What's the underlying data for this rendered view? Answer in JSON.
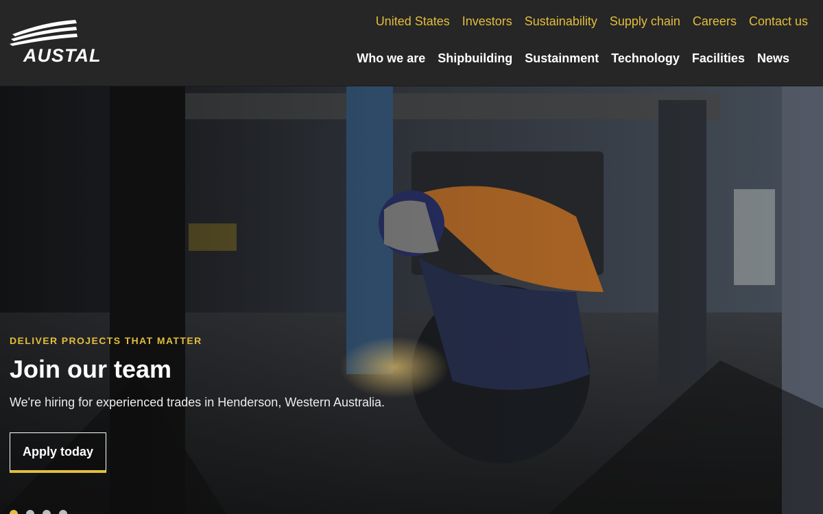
{
  "brand": {
    "name": "AUSTAL"
  },
  "utility_nav": [
    "United States",
    "Investors",
    "Sustainability",
    "Supply chain",
    "Careers",
    "Contact us"
  ],
  "main_nav": [
    "Who we are",
    "Shipbuilding",
    "Sustainment",
    "Technology",
    "Facilities",
    "News"
  ],
  "hero": {
    "eyebrow": "Deliver projects that matter",
    "title": "Join our team",
    "subtitle": "We're hiring for experienced trades in Henderson, Western Australia.",
    "cta": "Apply today",
    "slides": 4,
    "active_slide": 1
  },
  "colors": {
    "accent": "#e3be3b",
    "header_bg": "#262626",
    "text_light": "#ffffff"
  }
}
